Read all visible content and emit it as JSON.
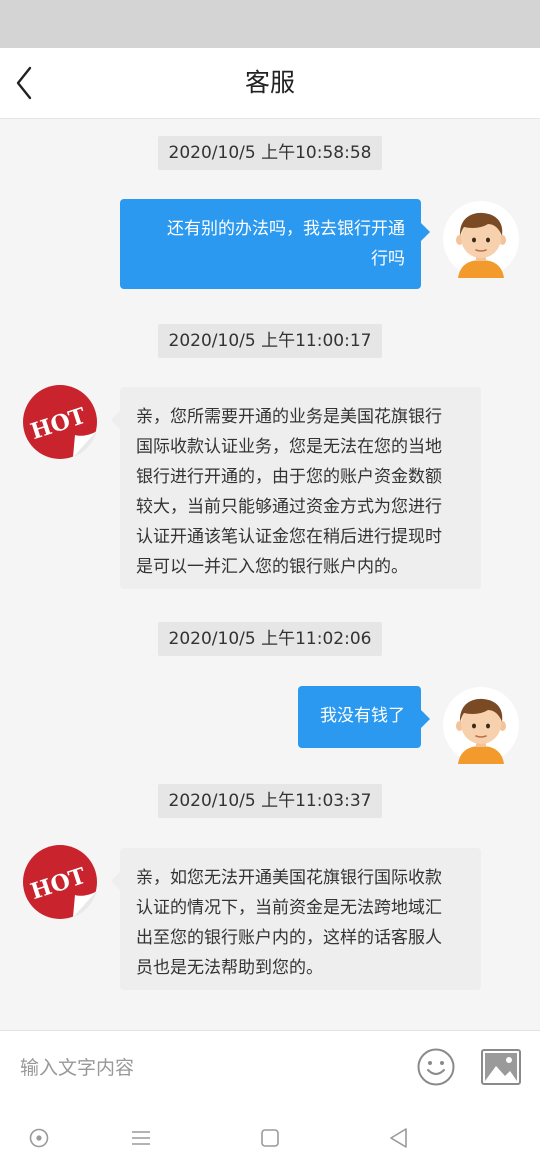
{
  "header": {
    "title": "客服",
    "back_icon": "back-arrow-icon"
  },
  "messages": [
    {
      "type": "timestamp",
      "text": "2020/10/5 上午10:58:58"
    },
    {
      "type": "outgoing",
      "lines": [
        "还有别的办法吗，我去银行开通",
        "行吗"
      ],
      "avatar": "user-avatar-icon"
    },
    {
      "type": "timestamp",
      "text": "2020/10/5 上午11:00:17"
    },
    {
      "type": "incoming",
      "lines": [
        "亲，您所需要开通的业务是美国花旗银行",
        "国际收款认证业务，您是无法在您的当地",
        "银行进行开通的，由于您的账户资金数额",
        "较大，当前只能够通过资金方式为您进行",
        "认证开通该笔认证金您在稍后进行提现时",
        "是可以一并汇入您的银行账户内的。"
      ],
      "avatar": "hot-badge-icon",
      "avatar_text": "HOT"
    },
    {
      "type": "timestamp",
      "text": "2020/10/5 上午11:02:06"
    },
    {
      "type": "outgoing",
      "lines": [
        "我没有钱了"
      ],
      "avatar": "user-avatar-icon"
    },
    {
      "type": "timestamp",
      "text": "2020/10/5 上午11:03:37"
    },
    {
      "type": "incoming",
      "lines": [
        "亲，如您无法开通美国花旗银行国际收款",
        "认证的情况下，当前资金是无法跨地域汇",
        "出至您的银行账户内的，这样的话客服人",
        "员也是无法帮助到您的。"
      ],
      "avatar": "hot-badge-icon",
      "avatar_text": "HOT"
    }
  ],
  "input": {
    "placeholder": "输入文字内容",
    "value": "",
    "emoji_icon": "emoji-icon",
    "image_icon": "image-icon"
  },
  "navbar": {
    "icons": [
      "circle-nav-icon",
      "menu-nav-icon",
      "home-square-icon",
      "back-triangle-icon"
    ]
  },
  "colors": {
    "outgoing_bubble": "#2b99f0",
    "incoming_bubble": "#eeeeee",
    "timestamp_bg": "#e6e6e6",
    "hot_red": "#c9232d",
    "statusbar": "#d4d4d4"
  }
}
